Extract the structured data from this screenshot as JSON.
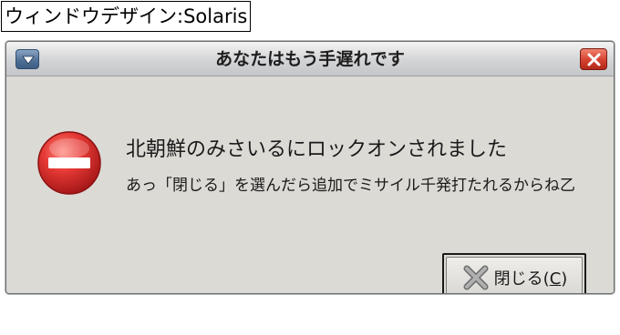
{
  "caption": {
    "text": "ウィンドウデザイン:Solaris"
  },
  "window": {
    "title": "あなたはもう手遅れです",
    "headline": "北朝鮮のみさいるにロックオンされました",
    "detail": "あっ「閉じる」を選んだら追加でミサイル千発打たれるからね乙",
    "icon": "stop-icon",
    "close_button": {
      "label": "閉じる(",
      "mnemonic": "C",
      "suffix": ")",
      "icon": "close-x-icon"
    }
  },
  "colors": {
    "window_bg": "#dcdad5",
    "stop_red": "#d92b2b",
    "titlebar_close": "#d5412f",
    "menu_button": "#4d6e95"
  }
}
